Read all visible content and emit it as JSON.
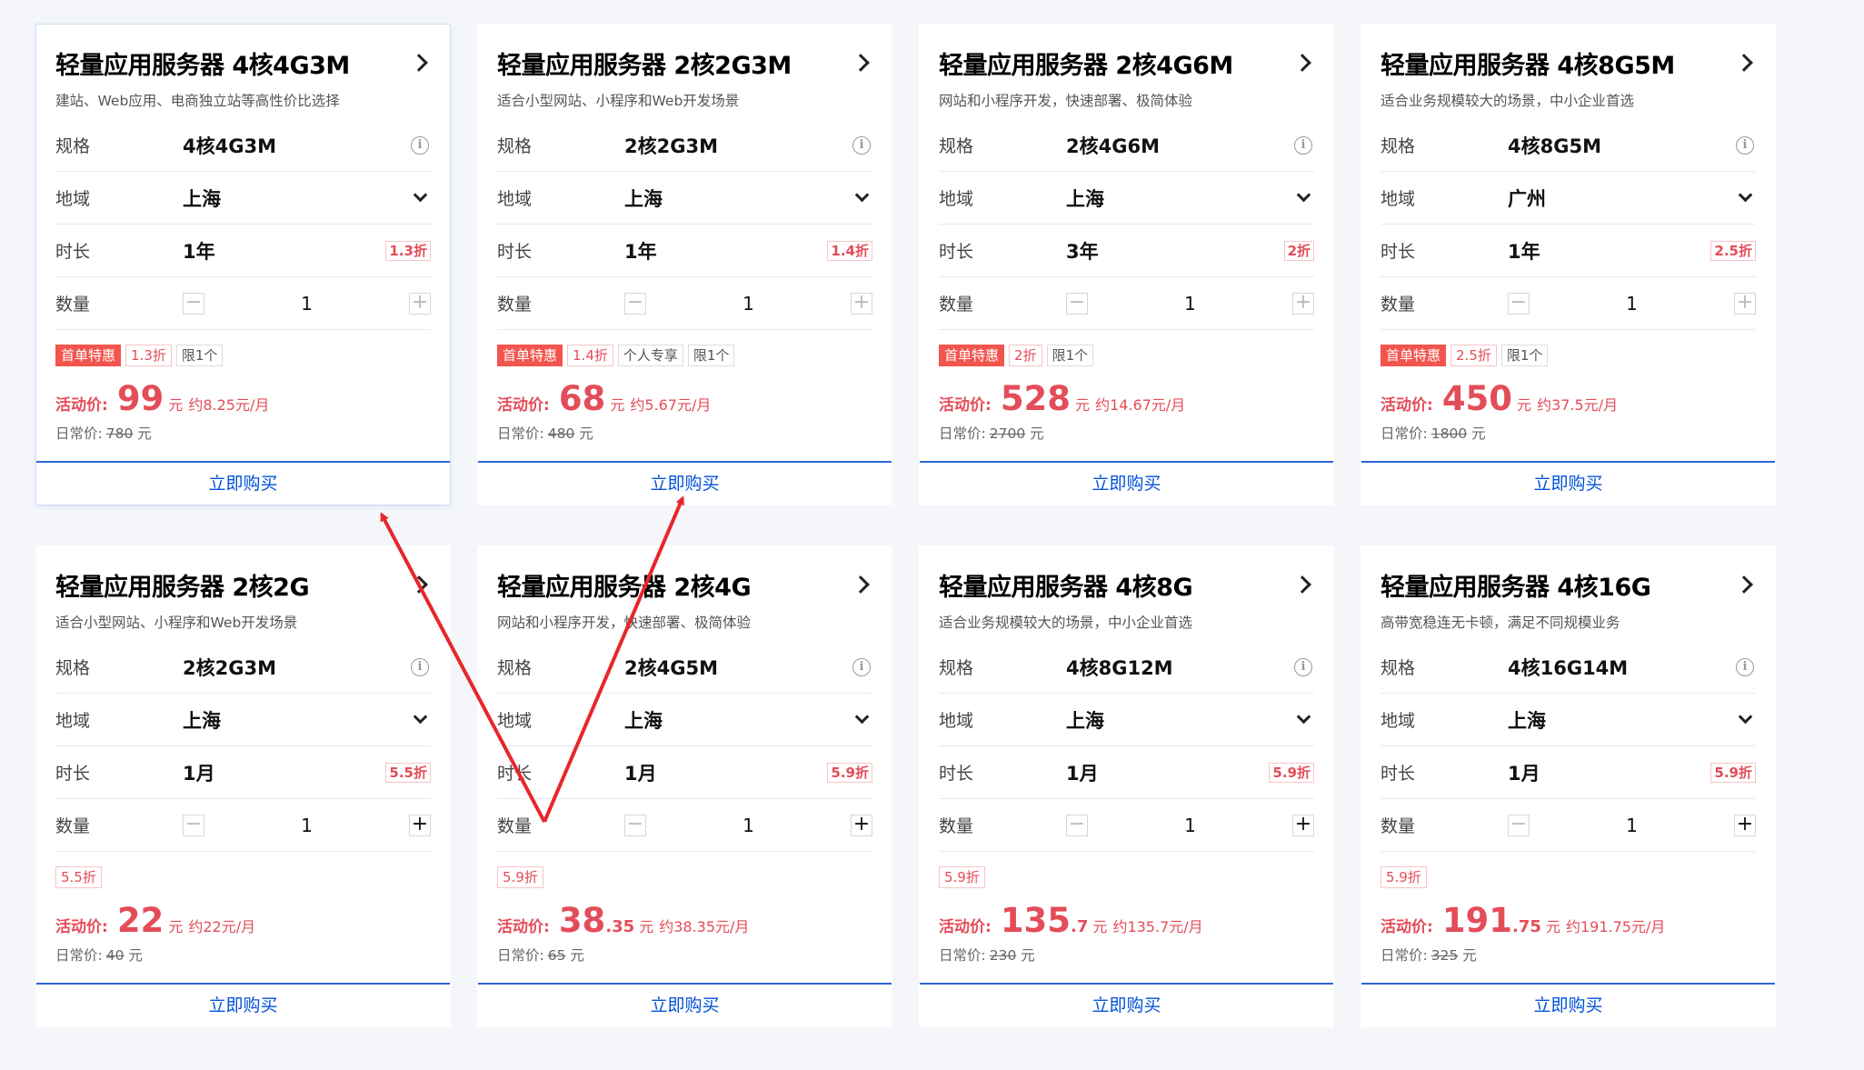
{
  "labels": {
    "spec": "规格",
    "region": "地域",
    "duration": "时长",
    "quantity": "数量",
    "activity_price": "活动价:",
    "regular_price": "日常价:",
    "yuan": "元",
    "buy": "立即购买",
    "info_glyph": "i",
    "minus": "−",
    "plus": "+"
  },
  "colors": {
    "accent_blue": "#0052d9",
    "price_red": "#e34d59",
    "hot_tag": "#f2554d",
    "arrow_red": "#e8262b"
  },
  "cards": [
    {
      "title": "轻量应用服务器 4核4G3M",
      "subtitle": "建站、Web应用、电商独立站等高性价比选择",
      "spec": "4核4G3M",
      "region": "上海",
      "duration": "1年",
      "duration_discount": "1.3折",
      "quantity": "1",
      "tags": [
        "首单特惠",
        "1.3折",
        "限1个"
      ],
      "price_int": "99",
      "price_dec": "",
      "monthly": "约8.25元/月",
      "regular": "780",
      "minus_disabled": true,
      "plus_disabled": true,
      "active": true
    },
    {
      "title": "轻量应用服务器 2核2G3M",
      "subtitle": "适合小型网站、小程序和Web开发场景",
      "spec": "2核2G3M",
      "region": "上海",
      "duration": "1年",
      "duration_discount": "1.4折",
      "quantity": "1",
      "tags": [
        "首单特惠",
        "1.4折",
        "个人专享",
        "限1个"
      ],
      "price_int": "68",
      "price_dec": "",
      "monthly": "约5.67元/月",
      "regular": "480",
      "minus_disabled": true,
      "plus_disabled": true,
      "active": false
    },
    {
      "title": "轻量应用服务器 2核4G6M",
      "subtitle": "网站和小程序开发，快速部署、极简体验",
      "spec": "2核4G6M",
      "region": "上海",
      "duration": "3年",
      "duration_discount": "2折",
      "quantity": "1",
      "tags": [
        "首单特惠",
        "2折",
        "限1个"
      ],
      "price_int": "528",
      "price_dec": "",
      "monthly": "约14.67元/月",
      "regular": "2700",
      "minus_disabled": true,
      "plus_disabled": true,
      "active": false
    },
    {
      "title": "轻量应用服务器 4核8G5M",
      "subtitle": "适合业务规模较大的场景，中小企业首选",
      "spec": "4核8G5M",
      "region": "广州",
      "duration": "1年",
      "duration_discount": "2.5折",
      "quantity": "1",
      "tags": [
        "首单特惠",
        "2.5折",
        "限1个"
      ],
      "price_int": "450",
      "price_dec": "",
      "monthly": "约37.5元/月",
      "regular": "1800",
      "minus_disabled": true,
      "plus_disabled": true,
      "active": false
    },
    {
      "title": "轻量应用服务器 2核2G",
      "subtitle": "适合小型网站、小程序和Web开发场景",
      "spec": "2核2G3M",
      "region": "上海",
      "duration": "1月",
      "duration_discount": "5.5折",
      "quantity": "1",
      "tags": [
        "5.5折"
      ],
      "price_int": "22",
      "price_dec": "",
      "monthly": "约22元/月",
      "regular": "40",
      "minus_disabled": true,
      "plus_disabled": false,
      "active": false
    },
    {
      "title": "轻量应用服务器 2核4G",
      "subtitle": "网站和小程序开发，快速部署、极简体验",
      "spec": "2核4G5M",
      "region": "上海",
      "duration": "1月",
      "duration_discount": "5.9折",
      "quantity": "1",
      "tags": [
        "5.9折"
      ],
      "price_int": "38",
      "price_dec": ".35",
      "monthly": "约38.35元/月",
      "regular": "65",
      "minus_disabled": true,
      "plus_disabled": false,
      "active": false
    },
    {
      "title": "轻量应用服务器 4核8G",
      "subtitle": "适合业务规模较大的场景，中小企业首选",
      "spec": "4核8G12M",
      "region": "上海",
      "duration": "1月",
      "duration_discount": "5.9折",
      "quantity": "1",
      "tags": [
        "5.9折"
      ],
      "price_int": "135",
      "price_dec": ".7",
      "monthly": "约135.7元/月",
      "regular": "230",
      "minus_disabled": true,
      "plus_disabled": false,
      "active": false
    },
    {
      "title": "轻量应用服务器 4核16G",
      "subtitle": "高带宽稳连无卡顿，满足不同规模业务",
      "spec": "4核16G14M",
      "region": "上海",
      "duration": "1月",
      "duration_discount": "5.9折",
      "quantity": "1",
      "tags": [
        "5.9折"
      ],
      "price_int": "191",
      "price_dec": ".75",
      "monthly": "约191.75元/月",
      "regular": "325",
      "minus_disabled": true,
      "plus_disabled": false,
      "active": false
    }
  ]
}
